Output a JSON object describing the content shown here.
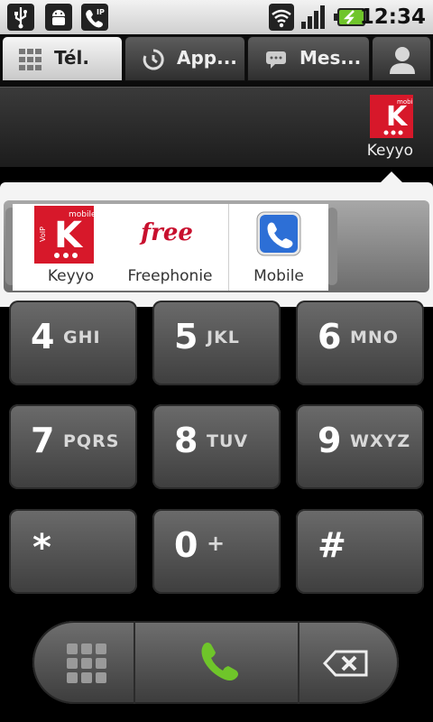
{
  "status_bar": {
    "time": "12:34",
    "left_icons": [
      "usb-icon",
      "android-debug-icon",
      "sip-call-icon"
    ],
    "right_icons": [
      "wifi-icon",
      "signal-icon",
      "battery-charging-icon"
    ]
  },
  "tabs": [
    {
      "label": "Tél.",
      "icon": "dialpad-icon",
      "active": true
    },
    {
      "label": "App...",
      "icon": "call-log-icon",
      "active": false
    },
    {
      "label": "Mes...",
      "icon": "message-icon",
      "active": false
    },
    {
      "label": "",
      "icon": "contacts-icon",
      "active": false
    }
  ],
  "header": {
    "selected_provider": "Keyyo"
  },
  "providers": [
    {
      "label": "Keyyo",
      "icon": "keyyo-logo"
    },
    {
      "label": "Freephonie",
      "icon": "free-logo"
    },
    {
      "label": "Mobile",
      "icon": "phone-icon"
    }
  ],
  "logo_text": {
    "keyyo_letter": "K",
    "keyyo_top": "mobile",
    "keyyo_side": "VoIP",
    "free": "free"
  },
  "keypad": [
    {
      "digit": "4",
      "letters": "GHI"
    },
    {
      "digit": "5",
      "letters": "JKL"
    },
    {
      "digit": "6",
      "letters": "MNO"
    },
    {
      "digit": "7",
      "letters": "PQRS"
    },
    {
      "digit": "8",
      "letters": "TUV"
    },
    {
      "digit": "9",
      "letters": "WXYZ"
    },
    {
      "digit": "*",
      "letters": ""
    },
    {
      "digit": "0",
      "letters": "+"
    },
    {
      "digit": "#",
      "letters": ""
    }
  ],
  "colors": {
    "call_green": "#6fc52a",
    "keyyo_red": "#d7182a",
    "free_red": "#c8102e",
    "mobile_blue": "#2d6fd6"
  }
}
